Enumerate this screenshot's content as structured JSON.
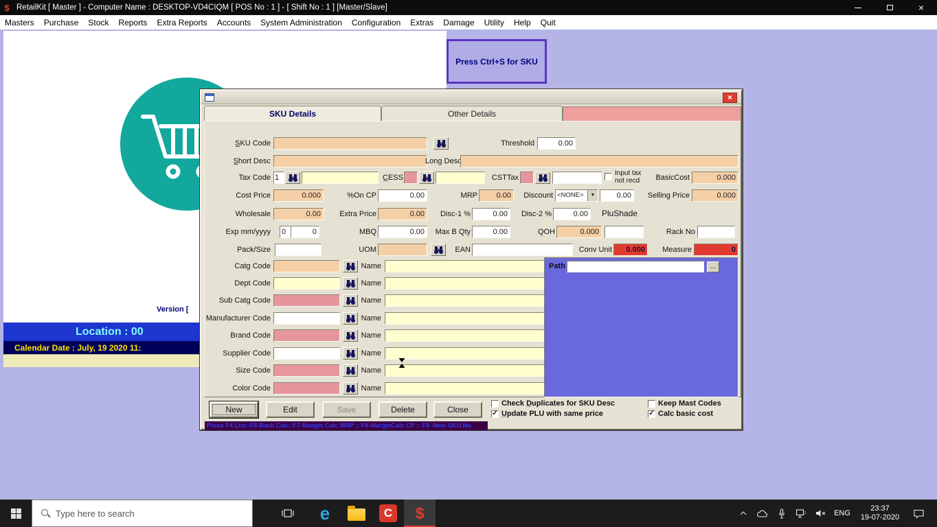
{
  "colors": {
    "desktop": "#b4b4e6",
    "peach_input": "#f5cfa5",
    "yellow_input": "#ffffcf",
    "pink_input": "#e5969c",
    "red_input": "#e23a30",
    "blue_panel": "#6a68dd",
    "pink_tab_strip": "#ef9f9e",
    "logo_teal": "#13a89e",
    "location_bar_blue": "#1f35cf",
    "calendar_bar_navy": "#00005a",
    "status_bar_purple": "#3c0045"
  },
  "icons": {
    "retailkit": "$",
    "edge": "e",
    "camtasia": "C",
    "close": "×",
    "dropdown_arrow": "▼"
  },
  "titlebar": {
    "title": "RetailKit [ Master ] - Computer Name : DESKTOP-VD4CIQM [ POS No : 1 ] - [ Shift No : 1 ] [Master/Slave]"
  },
  "menubar": {
    "items": [
      "Masters",
      "Purchase",
      "Stock",
      "Reports",
      "Extra Reports",
      "Accounts",
      "System Administration",
      "Configuration",
      "Extras",
      "Damage",
      "Utility",
      "Help",
      "Quit"
    ]
  },
  "main": {
    "ctrl_s_button": "Press Ctrl+S for SKU",
    "version_text": "Version [",
    "location_text": "Location : 00",
    "calendar_text": "Calendar Date : July, 19 2020 11:"
  },
  "dialog": {
    "tabs": {
      "sku": "SKU Details",
      "other": "Other Details"
    },
    "f": {
      "sku_code": "S̲KU Code",
      "threshold": "Threshold",
      "threshold_v": "0.00",
      "short_desc": "S̲hort Desc",
      "long_desc": "Long Desc",
      "tax_code": "Tax Code",
      "tax_code_v": "1",
      "cess": "C̲ESS",
      "csttax": "CSTTax",
      "input_tax_1": "Input tax",
      "input_tax_2": "not recd",
      "basic_cost": "BasicCost",
      "basic_cost_v": "0.000",
      "cost_price": "Cost Price",
      "cost_price_v": "0.000",
      "pct_on_cp": "%On CP",
      "pct_on_cp_v": "0.00",
      "mrp": "MRP",
      "mrp_v": "0.00",
      "discount": "Discount",
      "discount_sel": "<NONE>",
      "discount_v": "0.00",
      "selling_price": "Selling Price",
      "selling_price_v": "0.000",
      "wholesale": "Wholesale",
      "wholesale_v": "0.00",
      "extra_price": "Extra Price",
      "extra_price_v": "0.00",
      "disc1": "Disc-1 %",
      "disc1_v": "0.00",
      "disc2": "Disc-2 %",
      "disc2_v": "0.00",
      "plushade": "PluShade",
      "exp": "Exp mm/yyyy",
      "exp_mm_v": "0",
      "exp_yy_v": "0",
      "mbq": "MBQ",
      "mbq_v": "0.00",
      "max_b_qty": "Max B Qty",
      "max_b_qty_v": "0.00",
      "qoh": "QOH",
      "qoh_v": "0.000",
      "rack_no": "Rack No",
      "pack_size": "Pack/Size",
      "uom": "UOM",
      "ean": "EAN",
      "conv_unit": "Conv Unit",
      "conv_unit_v": "0.000",
      "measure": "Measure",
      "measure_v": "0",
      "catg_code": "Catg Code",
      "dept_code": "Dept Code",
      "sub_catg_code": "Sub Catg Code",
      "manufacturer_code": "Manufacturer Code",
      "brand_code": "Brand Code",
      "supplier_code": "Supplier Code",
      "size_code": "Size Code",
      "color_code": "Color Code",
      "name": "Name",
      "path": "Path",
      "browse": "..."
    },
    "buttons": {
      "new": "New",
      "edit": "Edit",
      "save": "Save",
      "delete": "Delete",
      "close": "Close"
    },
    "checks": {
      "dup": {
        "label": "Check D̲uplicates for SKU Desc",
        "mark": ""
      },
      "plu": {
        "label": "U̲pdate PLU with same price",
        "mark": "✓"
      },
      "keep": {
        "label": "Keep Mast Codes",
        "mark": ""
      },
      "calc": {
        "label": "Calc basic cost",
        "mark": "✓"
      }
    },
    "status_text": "Press F4 List::F6-Back Calc::F7-Margin Calc MRP :: F8-MarginCalc CP :: F9 -New SKU No"
  },
  "taskbar": {
    "search_placeholder": "Type here to search",
    "language": "ENG",
    "time": "23:37",
    "date": "19-07-2020"
  }
}
